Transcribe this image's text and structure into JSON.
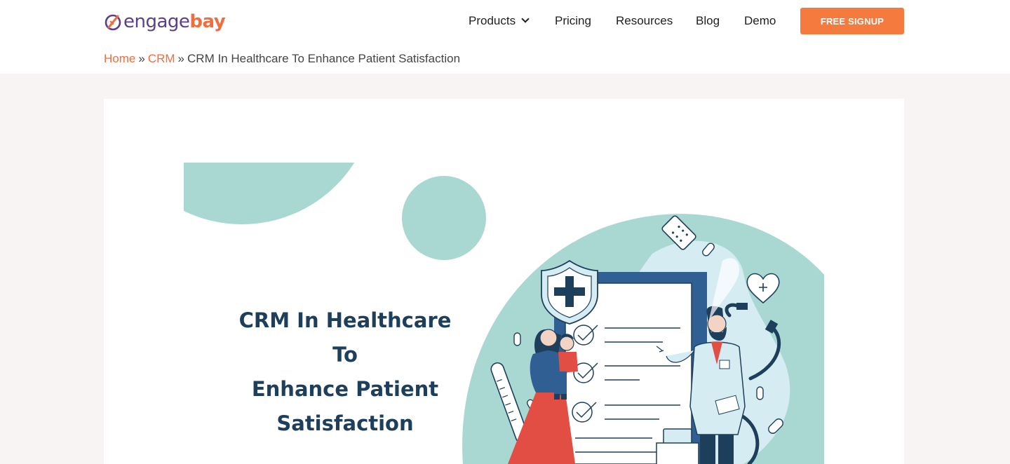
{
  "brand": {
    "logo_part1": "engage",
    "logo_part2": "bay",
    "colors": {
      "primary": "#5b3f8c",
      "accent": "#f26d3d",
      "button": "#f47a3e",
      "teal": "#a9d8d3",
      "navy": "#1e3f5c"
    }
  },
  "nav": {
    "products": "Products",
    "pricing": "Pricing",
    "resources": "Resources",
    "blog": "Blog",
    "demo": "Demo",
    "signup": "FREE SIGNUP"
  },
  "breadcrumb": {
    "home": "Home",
    "crm": "CRM",
    "separator": "»",
    "current": "CRM In Healthcare To Enhance Patient Satisfaction"
  },
  "hero": {
    "line1": "CRM In Healthcare",
    "line2": "To",
    "line3": "Enhance Patient",
    "line4": "Satisfaction"
  },
  "icons": [
    "engagebay-logo-icon",
    "chevron-down-icon",
    "shield-cross-icon",
    "heart-cross-icon",
    "pill-icon",
    "thermometer-icon",
    "checkmark-icon"
  ]
}
